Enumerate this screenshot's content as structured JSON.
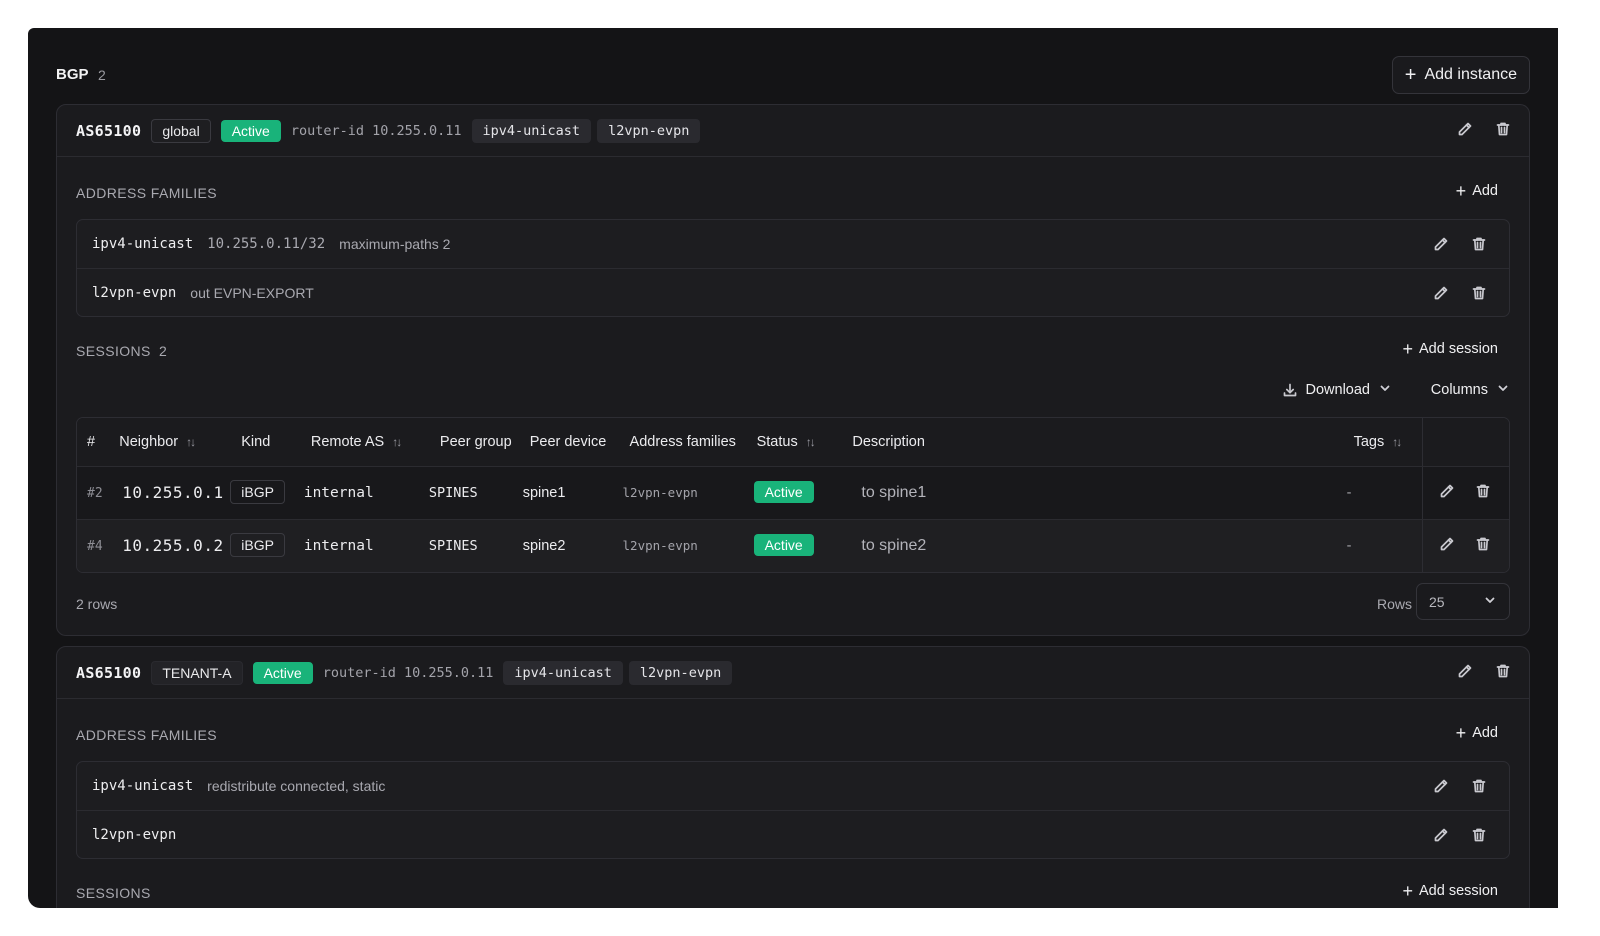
{
  "bgp": {
    "title": "BGP",
    "count": "2",
    "add_instance_label": "Add instance"
  },
  "instances": [
    {
      "asn": "AS65100",
      "vrf": "global",
      "status": "Active",
      "router_id": "router-id 10.255.0.11",
      "families": [
        "ipv4-unicast",
        "l2vpn-evpn"
      ],
      "address_families_label": "ADDRESS FAMILIES",
      "add_af_label": "Add",
      "af_rows": [
        {
          "name": "ipv4-unicast",
          "prefix": "10.255.0.11/32",
          "detail": "maximum-paths 2"
        },
        {
          "name": "l2vpn-evpn",
          "prefix": "",
          "detail": "out EVPN-EXPORT"
        }
      ],
      "sessions_label": "SESSIONS",
      "sessions_count": "2",
      "add_session_label": "Add session",
      "download_label": "Download",
      "columns_label": "Columns",
      "table": {
        "headers": [
          "#",
          "Neighbor",
          "Kind",
          "Remote AS",
          "Peer group",
          "Peer device",
          "Address families",
          "Status",
          "Description",
          "Tags"
        ],
        "rows": [
          {
            "num": "#2",
            "neighbor": "10.255.0.1",
            "kind": "iBGP",
            "remote_as": "internal",
            "peer_group": "SPINES",
            "peer_device": "spine1",
            "families": "l2vpn-evpn",
            "status": "Active",
            "description": "to spine1",
            "tags": "-"
          },
          {
            "num": "#4",
            "neighbor": "10.255.0.2",
            "kind": "iBGP",
            "remote_as": "internal",
            "peer_group": "SPINES",
            "peer_device": "spine2",
            "families": "l2vpn-evpn",
            "status": "Active",
            "description": "to spine2",
            "tags": "-"
          }
        ]
      },
      "rows_count": "2 rows",
      "rows_label": "Rows",
      "rows_per_page": "25"
    },
    {
      "asn": "AS65100",
      "vrf": "TENANT-A",
      "status": "Active",
      "router_id": "router-id 10.255.0.11",
      "families": [
        "ipv4-unicast",
        "l2vpn-evpn"
      ],
      "address_families_label": "ADDRESS FAMILIES",
      "add_af_label": "Add",
      "af_rows": [
        {
          "name": "ipv4-unicast",
          "prefix": "",
          "detail": "redistribute connected, static"
        },
        {
          "name": "l2vpn-evpn",
          "prefix": "",
          "detail": ""
        }
      ],
      "sessions_label": "SESSIONS",
      "add_session_label": "Add session"
    }
  ],
  "colors": {
    "active_badge": "#19b37a",
    "background": "#141416",
    "card": "#1b1b1e"
  },
  "icons": [
    "plus-icon",
    "pencil-icon",
    "trash-icon",
    "download-icon",
    "chevron-down-icon",
    "sort-icon"
  ]
}
